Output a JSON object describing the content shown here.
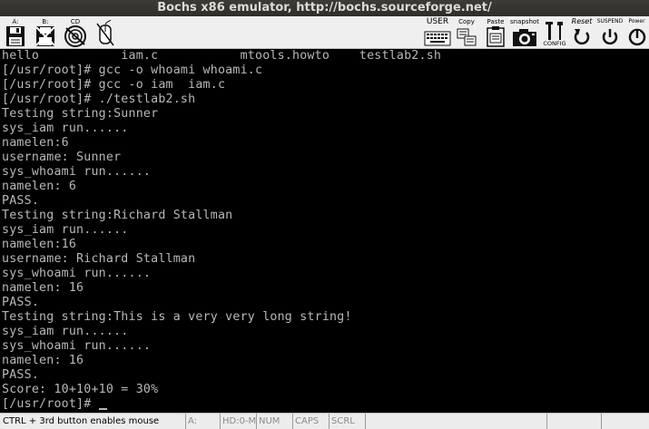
{
  "window": {
    "title": "Bochs x86 emulator, http://bochs.sourceforge.net/"
  },
  "toolbar": {
    "floppy_a_label": "A:",
    "floppy_b_label": "B:",
    "cdrom_label": "CD",
    "user_label": "USER",
    "copy_label": "Copy",
    "paste_label": "Paste",
    "snapshot_label": "snapshot",
    "config_label": "CONFIG",
    "reset_label": "Reset",
    "suspend_label": "SUSPEND",
    "power_label": "Power"
  },
  "terminal": {
    "lines": [
      "hello           iam.c           mtools.howto    testlab2.sh",
      "[/usr/root]# gcc -o whoami whoami.c",
      "[/usr/root]# gcc -o iam  iam.c",
      "[/usr/root]# ./testlab2.sh",
      "Testing string:Sunner",
      "sys_iam run......",
      "namelen:6",
      "username: Sunner",
      "sys_whoami run......",
      "namelen: 6",
      "PASS.",
      "Testing string:Richard Stallman",
      "sys_iam run......",
      "namelen:16",
      "username: Richard Stallman",
      "sys_whoami run......",
      "namelen: 16",
      "PASS.",
      "Testing string:This is a very very long string!",
      "sys_iam run......",
      "sys_whoami run......",
      "namelen: 16",
      "PASS.",
      "Score: 10+10+10 = 30%",
      "[/usr/root]# "
    ]
  },
  "statusbar": {
    "mouse_hint": "CTRL + 3rd button enables mouse",
    "drive_a": "A:",
    "drive_hd": "HD:0-M",
    "num": "NUM",
    "caps": "CAPS",
    "scrl": "SCRL"
  }
}
